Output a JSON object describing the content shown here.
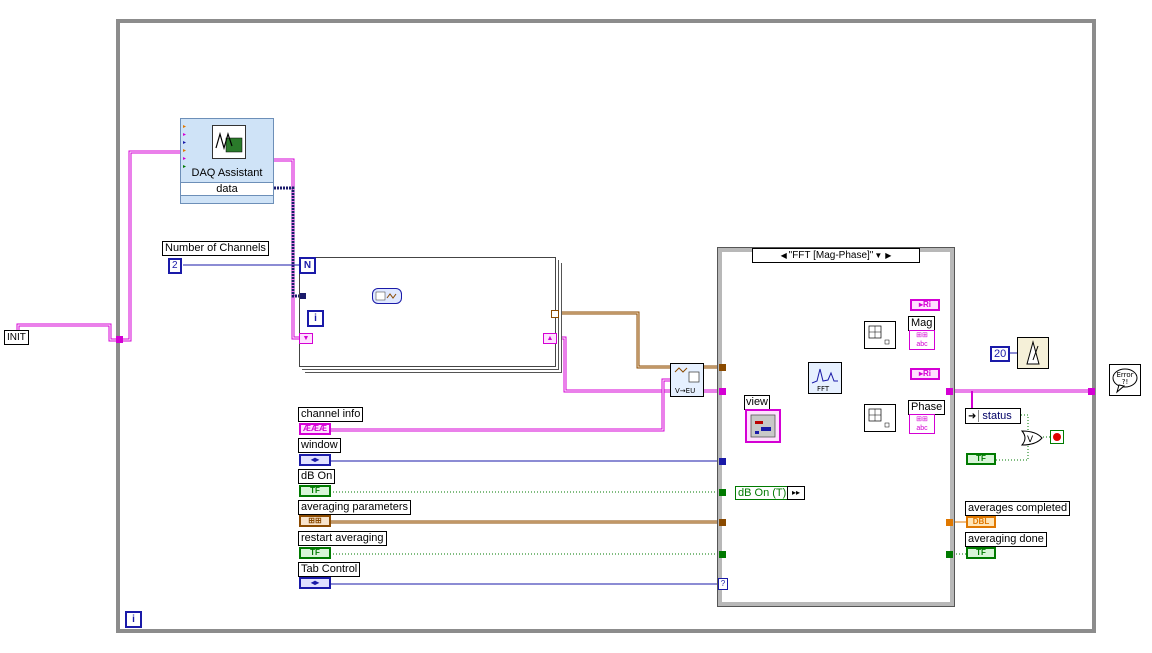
{
  "init_label": "INIT",
  "daq": {
    "title": "DAQ Assistant",
    "output": "data"
  },
  "num_channels": {
    "label": "Number of Channels",
    "value": "2"
  },
  "for_loop": {
    "count_terminal": "N",
    "index_terminal": "i"
  },
  "case_structure": {
    "selector": "\"FFT [Mag-Phase]\""
  },
  "controls": [
    {
      "label": "channel info",
      "glyph": "ÆÆÆ"
    },
    {
      "label": "window",
      "glyph": "◂▸"
    },
    {
      "label": "dB On",
      "glyph": "TF"
    },
    {
      "label": "averaging parameters",
      "glyph": "⊞⊞"
    },
    {
      "label": "restart averaging",
      "glyph": "TF"
    },
    {
      "label": "Tab Control",
      "glyph": "◂▸"
    }
  ],
  "view_label": "view",
  "db_on_true": "dB On (T)",
  "fft_vi": {
    "caption": "FFT"
  },
  "mag_label": "Mag",
  "phase_label": "Phase",
  "wait_value": "20",
  "status_label": "status",
  "outputs": {
    "averages_completed": "averages completed",
    "averaging_done": "averaging done",
    "dbl_glyph": "DBL",
    "tf_glyph": "TF"
  },
  "error_vi": "Error",
  "while_index": "i",
  "colors": {
    "cluster_pink": "#d400d4",
    "integer_blue": "#1a1aa8",
    "boolean_green": "#007a00",
    "waveform_brown": "#8a4a00",
    "double_orange": "#e07800"
  }
}
